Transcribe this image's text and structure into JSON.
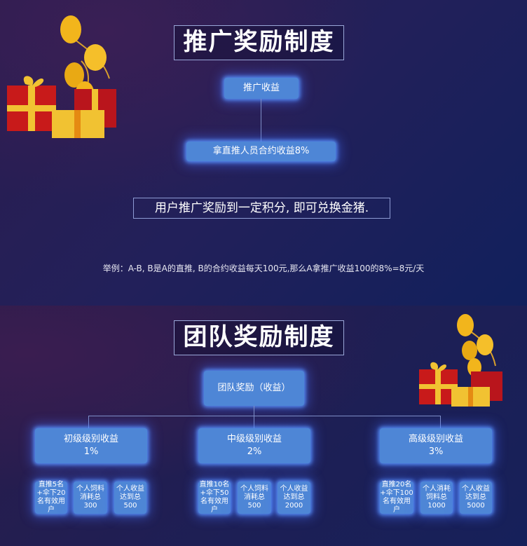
{
  "referral": {
    "title": "推广奖励制度",
    "top_node": "推广收益",
    "rule_node": "拿直推人员合约收益8%",
    "note": "用户推广奖励到一定积分, 即可兑换金猪.",
    "example": "举例：A-B, B是A的直推, B的合约收益每天100元,那么A拿推广收益100的8%=8元/天"
  },
  "team": {
    "title": "团队奖励制度",
    "root": "团队奖励（收益）",
    "levels": [
      {
        "name": "初级级别收益",
        "percent": "1%",
        "reqs": [
          {
            "text": "直推5名+伞下20名有效用户"
          },
          {
            "text": "个人饲料消耗总",
            "value": "300"
          },
          {
            "text": "个人收益达到总",
            "value": "500"
          }
        ]
      },
      {
        "name": "中级级别收益",
        "percent": "2%",
        "reqs": [
          {
            "text": "直推10名+伞下50名有效用户"
          },
          {
            "text": "个人饲料消耗总",
            "value": "500"
          },
          {
            "text": "个人收益达到总",
            "value": "2000"
          }
        ]
      },
      {
        "name": "高级级别收益",
        "percent": "3%",
        "reqs": [
          {
            "text": "直推20名+伞下100名有效用户"
          },
          {
            "text": "个人消耗饲料总",
            "value": "1000"
          },
          {
            "text": "个人收益达到总",
            "value": "5000"
          }
        ]
      }
    ]
  },
  "colors": {
    "node_fill": "#4e86d6",
    "glow": "#5a96ff",
    "background": "#22205a"
  },
  "decorations": [
    "gift-balloons-icon",
    "gift-balloons-icon"
  ]
}
